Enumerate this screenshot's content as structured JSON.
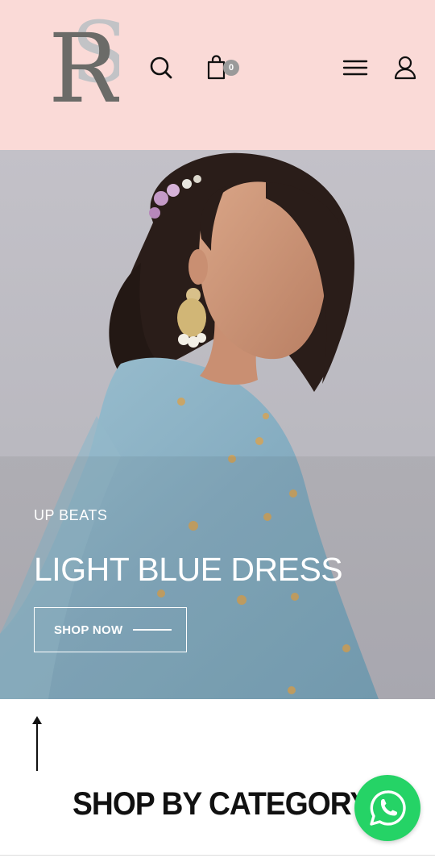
{
  "header": {
    "logo_text": "RS",
    "cart_count": "0",
    "background": "#fadad7"
  },
  "hero": {
    "eyebrow": "UP BEATS",
    "title": "LIGHT BLUE DRESS",
    "cta_label": "SHOP NOW"
  },
  "section": {
    "title": "SHOP BY CATEGORY"
  },
  "icons": {
    "search": "search-icon",
    "cart": "shopping-bag-icon",
    "menu": "hamburger-menu-icon",
    "account": "user-icon",
    "scroll": "arrow-up-icon",
    "chat": "whatsapp-icon"
  },
  "colors": {
    "header_bg": "#fadad7",
    "whatsapp": "#25d366",
    "dress": "#8fb4c6"
  }
}
